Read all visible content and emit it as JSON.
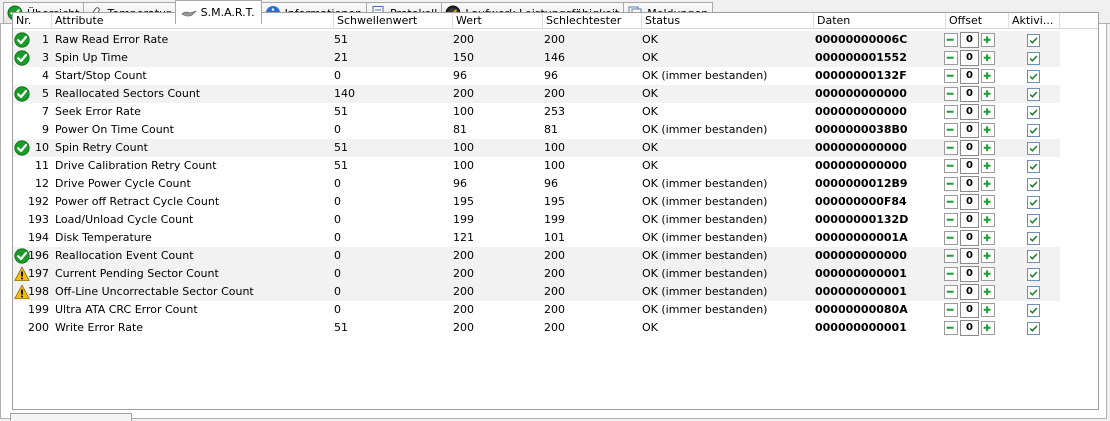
{
  "colors": {
    "ok": "#1a9c2a",
    "warning": "#f5c000",
    "button_green": "#1f9e37"
  },
  "tabs": [
    {
      "label": "Übersicht",
      "icon": "check-circle-icon"
    },
    {
      "label": "Temperatur",
      "icon": "thermometer-icon"
    },
    {
      "label": "S.M.A.R.T.",
      "icon": "smart-bird-icon"
    },
    {
      "label": "Informationen",
      "icon": "info-icon"
    },
    {
      "label": "Protokoll",
      "icon": "document-icon"
    },
    {
      "label": "Laufwerk Leistungsfähigkeit",
      "icon": "gauge-icon"
    },
    {
      "label": "Meldungen",
      "icon": "messages-icon"
    }
  ],
  "active_tab": "S.M.A.R.T.",
  "columns": [
    "Nr.",
    "Attribute",
    "Schwellenwert",
    "Wert",
    "Schlechtester",
    "Status",
    "Daten",
    "Offset",
    "Aktivi..."
  ],
  "rows": [
    {
      "nr": "1",
      "attribute": "Raw Read Error Rate",
      "threshold": "51",
      "value": "200",
      "worst": "200",
      "status": "OK",
      "data": "00000000006C",
      "offset": "0",
      "icon": "ok",
      "shaded": true,
      "active": true
    },
    {
      "nr": "3",
      "attribute": "Spin Up Time",
      "threshold": "21",
      "value": "150",
      "worst": "146",
      "status": "OK",
      "data": "000000001552",
      "offset": "0",
      "icon": "ok",
      "shaded": true,
      "active": true
    },
    {
      "nr": "4",
      "attribute": "Start/Stop Count",
      "threshold": "0",
      "value": "96",
      "worst": "96",
      "status": "OK (immer bestanden)",
      "data": "00000000132F",
      "offset": "0",
      "icon": "",
      "shaded": false,
      "active": true
    },
    {
      "nr": "5",
      "attribute": "Reallocated Sectors Count",
      "threshold": "140",
      "value": "200",
      "worst": "200",
      "status": "OK",
      "data": "000000000000",
      "offset": "0",
      "icon": "ok",
      "shaded": true,
      "active": true
    },
    {
      "nr": "7",
      "attribute": "Seek Error Rate",
      "threshold": "51",
      "value": "100",
      "worst": "253",
      "status": "OK",
      "data": "000000000000",
      "offset": "0",
      "icon": "",
      "shaded": false,
      "active": true
    },
    {
      "nr": "9",
      "attribute": "Power On Time Count",
      "threshold": "0",
      "value": "81",
      "worst": "81",
      "status": "OK (immer bestanden)",
      "data": "0000000038B0",
      "offset": "0",
      "icon": "",
      "shaded": false,
      "active": true
    },
    {
      "nr": "10",
      "attribute": "Spin Retry Count",
      "threshold": "51",
      "value": "100",
      "worst": "100",
      "status": "OK",
      "data": "000000000000",
      "offset": "0",
      "icon": "ok",
      "shaded": true,
      "active": true
    },
    {
      "nr": "11",
      "attribute": "Drive Calibration Retry Count",
      "threshold": "51",
      "value": "100",
      "worst": "100",
      "status": "OK",
      "data": "000000000000",
      "offset": "0",
      "icon": "",
      "shaded": false,
      "active": true
    },
    {
      "nr": "12",
      "attribute": "Drive Power Cycle Count",
      "threshold": "0",
      "value": "96",
      "worst": "96",
      "status": "OK (immer bestanden)",
      "data": "0000000012B9",
      "offset": "0",
      "icon": "",
      "shaded": false,
      "active": true
    },
    {
      "nr": "192",
      "attribute": "Power off Retract Cycle Count",
      "threshold": "0",
      "value": "195",
      "worst": "195",
      "status": "OK (immer bestanden)",
      "data": "000000000F84",
      "offset": "0",
      "icon": "",
      "shaded": false,
      "active": true
    },
    {
      "nr": "193",
      "attribute": "Load/Unload Cycle Count",
      "threshold": "0",
      "value": "199",
      "worst": "199",
      "status": "OK (immer bestanden)",
      "data": "00000000132D",
      "offset": "0",
      "icon": "",
      "shaded": false,
      "active": true
    },
    {
      "nr": "194",
      "attribute": "Disk Temperature",
      "threshold": "0",
      "value": "121",
      "worst": "101",
      "status": "OK (immer bestanden)",
      "data": "00000000001A",
      "offset": "0",
      "icon": "",
      "shaded": false,
      "active": true
    },
    {
      "nr": "196",
      "attribute": "Reallocation Event Count",
      "threshold": "0",
      "value": "200",
      "worst": "200",
      "status": "OK (immer bestanden)",
      "data": "000000000000",
      "offset": "0",
      "icon": "ok",
      "shaded": true,
      "active": true
    },
    {
      "nr": "197",
      "attribute": "Current Pending Sector Count",
      "threshold": "0",
      "value": "200",
      "worst": "200",
      "status": "OK (immer bestanden)",
      "data": "000000000001",
      "offset": "0",
      "icon": "warning",
      "shaded": true,
      "active": true
    },
    {
      "nr": "198",
      "attribute": "Off-Line Uncorrectable Sector Count",
      "threshold": "0",
      "value": "200",
      "worst": "200",
      "status": "OK (immer bestanden)",
      "data": "000000000001",
      "offset": "0",
      "icon": "warning",
      "shaded": true,
      "active": true
    },
    {
      "nr": "199",
      "attribute": "Ultra ATA CRC Error Count",
      "threshold": "0",
      "value": "200",
      "worst": "200",
      "status": "OK (immer bestanden)",
      "data": "00000000080A",
      "offset": "0",
      "icon": "",
      "shaded": false,
      "active": true
    },
    {
      "nr": "200",
      "attribute": "Write Error Rate",
      "threshold": "51",
      "value": "200",
      "worst": "200",
      "status": "OK",
      "data": "000000000001",
      "offset": "0",
      "icon": "",
      "shaded": false,
      "active": true
    }
  ]
}
